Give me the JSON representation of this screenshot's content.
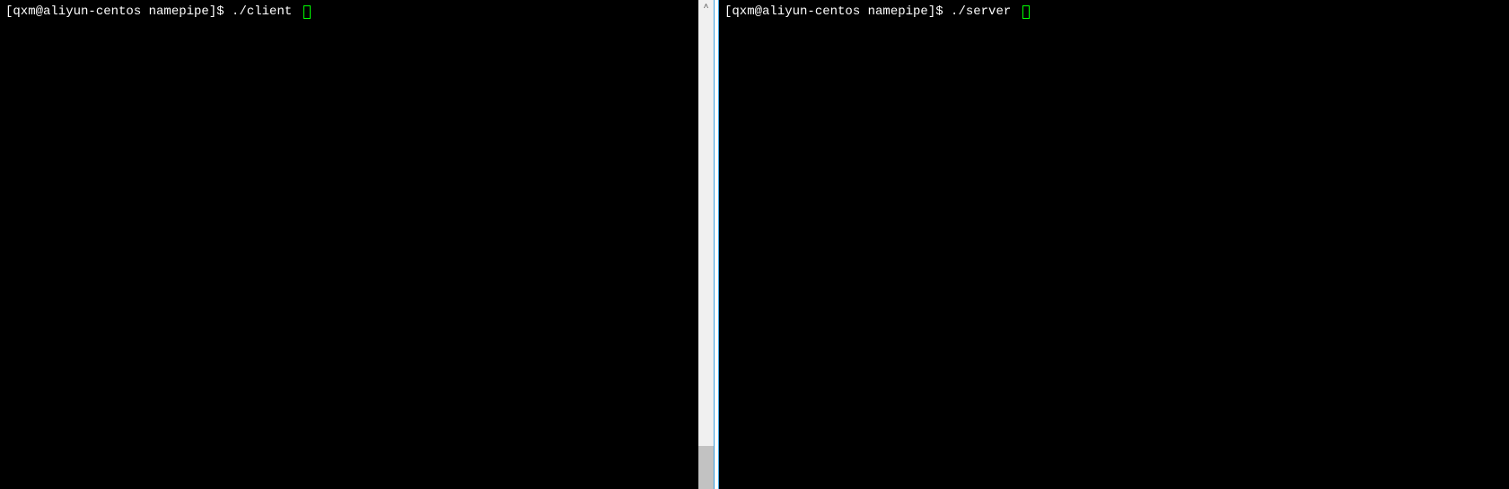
{
  "left_terminal": {
    "prompt": "[qxm@aliyun-centos namepipe]$ ",
    "command": "./client ",
    "cursor_color": "#00ff00"
  },
  "right_terminal": {
    "prompt": "[qxm@aliyun-centos namepipe]$ ",
    "command": "./server ",
    "cursor_color": "#00ff00"
  },
  "scrollbar": {
    "arrow_up_glyph": "˄"
  }
}
